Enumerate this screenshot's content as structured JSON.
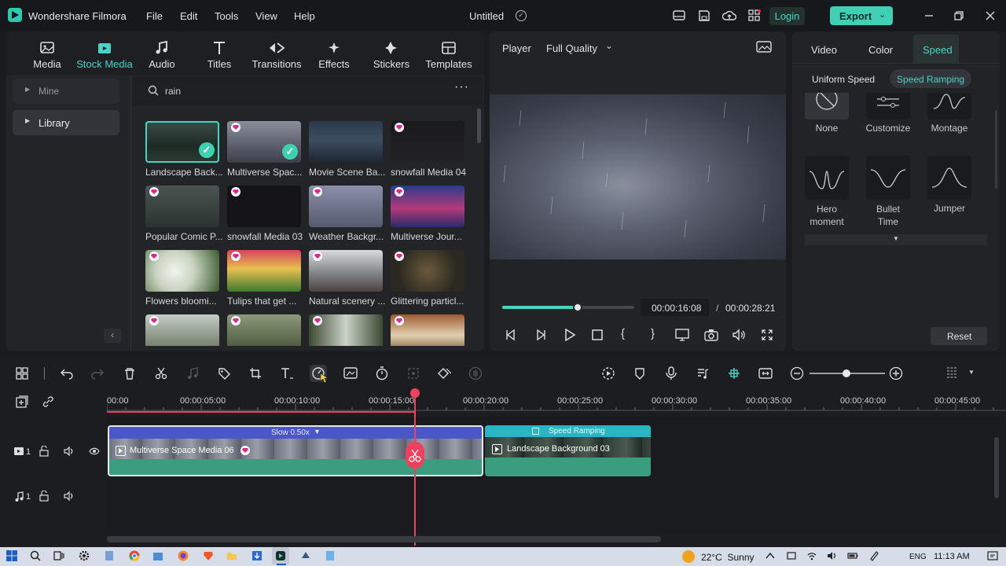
{
  "app": {
    "name": "Wondershare Filmora",
    "doc_title": "Untitled",
    "login": "Login",
    "export": "Export"
  },
  "menu": [
    "File",
    "Edit",
    "Tools",
    "View",
    "Help"
  ],
  "media_tabs": [
    {
      "label": "Media",
      "icon": "media-icon"
    },
    {
      "label": "Stock Media",
      "icon": "stock-media-icon"
    },
    {
      "label": "Audio",
      "icon": "audio-icon"
    },
    {
      "label": "Titles",
      "icon": "titles-icon"
    },
    {
      "label": "Transitions",
      "icon": "transitions-icon"
    },
    {
      "label": "Effects",
      "icon": "effects-icon"
    },
    {
      "label": "Stickers",
      "icon": "stickers-icon"
    },
    {
      "label": "Templates",
      "icon": "templates-icon"
    }
  ],
  "sidebar": {
    "items": [
      "Mine",
      "Library"
    ]
  },
  "search": {
    "value": "rain"
  },
  "media_items": [
    {
      "label": "Landscape Back...",
      "premium": false,
      "checked": true
    },
    {
      "label": "Multiverse Spac...",
      "premium": true,
      "checked": true
    },
    {
      "label": "Movie Scene Ba...",
      "premium": false,
      "checked": false
    },
    {
      "label": "snowfall Media 04",
      "premium": true,
      "checked": false
    },
    {
      "label": "Popular Comic P...",
      "premium": true,
      "checked": false
    },
    {
      "label": "snowfall Media 03",
      "premium": true,
      "checked": false
    },
    {
      "label": "Weather Backgr...",
      "premium": true,
      "checked": false
    },
    {
      "label": "Multiverse Jour...",
      "premium": true,
      "checked": false
    },
    {
      "label": "Flowers bloomi...",
      "premium": true,
      "checked": false
    },
    {
      "label": "Tulips that get ...",
      "premium": true,
      "checked": false
    },
    {
      "label": "Natural scenery ...",
      "premium": true,
      "checked": false
    },
    {
      "label": "Glittering particl...",
      "premium": true,
      "checked": false
    },
    {
      "label": "",
      "premium": true,
      "checked": false
    },
    {
      "label": "",
      "premium": true,
      "checked": false
    },
    {
      "label": "",
      "premium": true,
      "checked": false
    },
    {
      "label": "",
      "premium": true,
      "checked": false
    }
  ],
  "player": {
    "label": "Player",
    "quality": "Full Quality",
    "current_time": "00:00:16:08",
    "separator": "/",
    "total_time": "00:00:28:21",
    "progress": 0.57
  },
  "right_panel": {
    "tabs": [
      "Video",
      "Color",
      "Speed"
    ],
    "subtabs": [
      "Uniform Speed",
      "Speed Ramping"
    ],
    "presets": [
      "None",
      "Customize",
      "Montage",
      "Hero moment",
      "Bullet Time",
      "Jumper"
    ],
    "reset": "Reset"
  },
  "timeline": {
    "ruler": [
      "00:00",
      "00:00:05:00",
      "00:00:10:00",
      "00:00:15:00",
      "00:00:20:00",
      "00:00:25:00",
      "00:00:30:00",
      "00:00:35:00",
      "00:00:40:00",
      "00:00:45:00"
    ],
    "clip1": {
      "speed": "Slow 0.50x",
      "name": "Multiverse Space Media 06"
    },
    "clip2": {
      "speed": "Speed Ramping",
      "name": "Landscape Background 03"
    },
    "video_track": "1",
    "audio_track": "1"
  },
  "taskbar": {
    "weather": "22°C  Sunny",
    "lang": "ENG",
    "time": "11:13 AM"
  },
  "colors": {
    "accent": "#49d3c4",
    "export_btn": "#3fd0b5",
    "playhead": "#f0415c",
    "clip": "#3a9d7e",
    "speed_bar": "#4a56c9"
  }
}
